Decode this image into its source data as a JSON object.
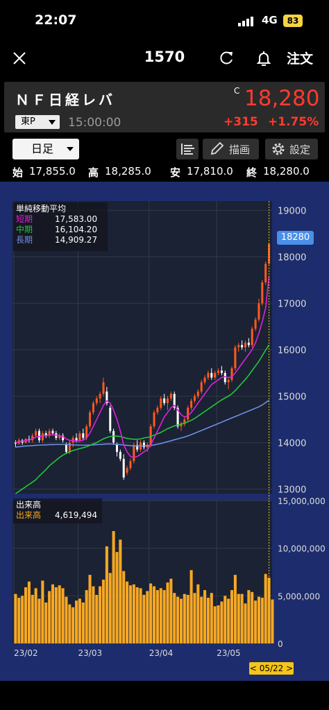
{
  "status_bar": {
    "time": "22:07",
    "network": "4G",
    "battery": "83"
  },
  "header": {
    "code": "1570",
    "order_label": "注文"
  },
  "stock": {
    "name": "ＮＦ日経レバ",
    "market": "東P",
    "time": "15:00:00",
    "c_mark": "C",
    "price": "18,280",
    "change": "+315",
    "change_pct": "+1.75%"
  },
  "toolbar": {
    "period": "日足",
    "draw_label": "描画",
    "settings_label": "設定"
  },
  "ohlc": {
    "open_label": "始",
    "open": "17,855.0",
    "high_label": "高",
    "high": "18,285.0",
    "low_label": "安",
    "low": "17,810.0",
    "close_label": "終",
    "close": "18,280.0"
  },
  "ma_legend": {
    "title": "単純移動平均",
    "short_label": "短期",
    "short_value": "17,583.00",
    "mid_label": "中期",
    "mid_value": "16,104.20",
    "long_label": "長期",
    "long_value": "14,909.27"
  },
  "volume_legend": {
    "title": "出来高",
    "label": "出来高",
    "value": "4,619,494"
  },
  "price_tag": "18280",
  "date_tag": "< 05/22 >",
  "colors": {
    "up": "#ff5a1f",
    "down": "#ffffff",
    "short_ma": "#e020e0",
    "mid_ma": "#22c93a",
    "long_ma": "#6f8fe6",
    "volume": "#f7a823",
    "chart_bg": "#1c2c6c",
    "price_red": "#ff3b30"
  },
  "chart_data": [
    {
      "type": "candlestick",
      "y_axis": {
        "ticks": [
          13000,
          14000,
          15000,
          16000,
          17000,
          18000,
          19000
        ],
        "range": [
          12900,
          19200
        ]
      },
      "x_ticks": [
        "23/02",
        "23/03",
        "23/04",
        "23/05"
      ],
      "candles": [
        [
          14000,
          14050,
          13900,
          13980
        ],
        [
          13980,
          14100,
          13950,
          14050
        ],
        [
          14050,
          14080,
          13950,
          14000
        ],
        [
          14000,
          14100,
          13980,
          14080
        ],
        [
          14080,
          14150,
          14000,
          14050
        ],
        [
          14050,
          14200,
          14000,
          14150
        ],
        [
          14150,
          14300,
          14100,
          14250
        ],
        [
          14250,
          14300,
          14000,
          14050
        ],
        [
          14050,
          14250,
          14000,
          14200
        ],
        [
          14200,
          14250,
          14100,
          14150
        ],
        [
          14150,
          14300,
          14100,
          14250
        ],
        [
          14250,
          14300,
          14150,
          14200
        ],
        [
          14200,
          14250,
          14050,
          14100
        ],
        [
          14100,
          14200,
          14050,
          14150
        ],
        [
          14150,
          14200,
          14000,
          14050
        ],
        [
          13950,
          14000,
          13750,
          13800
        ],
        [
          13800,
          14050,
          13750,
          14000
        ],
        [
          14000,
          14150,
          13900,
          14100
        ],
        [
          14100,
          14200,
          14000,
          14050
        ],
        [
          14050,
          14250,
          14000,
          14200
        ],
        [
          14200,
          14300,
          14050,
          14100
        ],
        [
          14100,
          14400,
          14050,
          14350
        ],
        [
          14350,
          14700,
          14300,
          14650
        ],
        [
          14650,
          14900,
          14600,
          14850
        ],
        [
          14850,
          15000,
          14800,
          14950
        ],
        [
          14950,
          15100,
          14850,
          15050
        ],
        [
          15050,
          15400,
          15000,
          15300
        ],
        [
          15100,
          15200,
          14800,
          14850
        ],
        [
          14750,
          14800,
          14200,
          14250
        ],
        [
          14250,
          14300,
          13950,
          14000
        ],
        [
          13950,
          14000,
          13700,
          13800
        ],
        [
          13800,
          13850,
          13600,
          13650
        ],
        [
          13650,
          13750,
          13200,
          13250
        ],
        [
          13350,
          13500,
          13300,
          13450
        ],
        [
          13450,
          13650,
          13400,
          13600
        ],
        [
          13600,
          14000,
          13550,
          13950
        ],
        [
          13950,
          14050,
          13800,
          13850
        ],
        [
          13850,
          14050,
          13800,
          14000
        ],
        [
          14000,
          14050,
          13850,
          13900
        ],
        [
          13900,
          14000,
          13800,
          13950
        ],
        [
          13950,
          14400,
          13900,
          14350
        ],
        [
          14350,
          14700,
          14300,
          14650
        ],
        [
          14650,
          14800,
          14600,
          14750
        ],
        [
          14750,
          15000,
          14700,
          14950
        ],
        [
          14950,
          15050,
          14800,
          14850
        ],
        [
          14850,
          15000,
          14700,
          14950
        ],
        [
          14950,
          15100,
          14900,
          15050
        ],
        [
          15050,
          15100,
          14700,
          14750
        ],
        [
          14750,
          14800,
          14300,
          14350
        ],
        [
          14350,
          14450,
          14250,
          14400
        ],
        [
          14400,
          14550,
          14350,
          14500
        ],
        [
          14500,
          14800,
          14450,
          14750
        ],
        [
          14750,
          14950,
          14700,
          14900
        ],
        [
          14900,
          15050,
          14850,
          15000
        ],
        [
          15000,
          15150,
          14950,
          15100
        ],
        [
          15100,
          15350,
          15050,
          15300
        ],
        [
          15300,
          15450,
          15250,
          15400
        ],
        [
          15400,
          15550,
          15350,
          15500
        ],
        [
          15500,
          15600,
          15350,
          15400
        ],
        [
          15400,
          15550,
          15350,
          15500
        ],
        [
          15500,
          15600,
          15450,
          15550
        ],
        [
          15550,
          15650,
          15450,
          15500
        ],
        [
          15500,
          15550,
          15250,
          15300
        ],
        [
          15300,
          15400,
          15150,
          15350
        ],
        [
          15350,
          15650,
          15300,
          15600
        ],
        [
          15600,
          16100,
          15550,
          16050
        ],
        [
          16050,
          16150,
          15950,
          16100
        ],
        [
          16100,
          16200,
          16000,
          16050
        ],
        [
          16050,
          16200,
          15950,
          16150
        ],
        [
          16150,
          16250,
          16050,
          16100
        ],
        [
          16100,
          16500,
          16050,
          16450
        ],
        [
          16450,
          16700,
          16400,
          16650
        ],
        [
          16650,
          17100,
          16600,
          17000
        ],
        [
          17000,
          17500,
          16950,
          17450
        ],
        [
          17450,
          17900,
          17400,
          17850
        ],
        [
          17855,
          18285,
          17810,
          18280
        ]
      ],
      "ma_short": [
        14000,
        14020,
        14030,
        14040,
        14060,
        14080,
        14120,
        14130,
        14150,
        14150,
        14160,
        14170,
        14160,
        14150,
        14130,
        14080,
        14050,
        14040,
        14030,
        14040,
        14050,
        14100,
        14200,
        14350,
        14500,
        14650,
        14800,
        14900,
        14850,
        14700,
        14500,
        14250,
        13950,
        13800,
        13700,
        13680,
        13700,
        13750,
        13800,
        13850,
        13950,
        14100,
        14250,
        14400,
        14550,
        14650,
        14750,
        14800,
        14700,
        14600,
        14550,
        14580,
        14650,
        14750,
        14850,
        14950,
        15050,
        15150,
        15250,
        15300,
        15350,
        15400,
        15420,
        15400,
        15420,
        15500,
        15600,
        15700,
        15800,
        15900,
        16000,
        16150,
        16350,
        16600,
        16900,
        17580
      ],
      "ma_mid": [
        12900,
        12950,
        13000,
        13050,
        13100,
        13150,
        13200,
        13280,
        13350,
        13420,
        13500,
        13560,
        13620,
        13680,
        13730,
        13770,
        13800,
        13830,
        13850,
        13870,
        13890,
        13910,
        13940,
        13970,
        14000,
        14040,
        14080,
        14110,
        14130,
        14140,
        14140,
        14130,
        14110,
        14090,
        14080,
        14070,
        14070,
        14080,
        14100,
        14110,
        14130,
        14160,
        14190,
        14220,
        14260,
        14300,
        14330,
        14360,
        14380,
        14400,
        14420,
        14450,
        14480,
        14520,
        14570,
        14620,
        14670,
        14720,
        14770,
        14820,
        14870,
        14920,
        14960,
        15000,
        15050,
        15120,
        15200,
        15280,
        15360,
        15450,
        15550,
        15650,
        15750,
        15870,
        15990,
        16104
      ],
      "ma_long": [
        13900,
        13910,
        13920,
        13925,
        13930,
        13935,
        13940,
        13945,
        13950,
        13950,
        13955,
        13955,
        13960,
        13960,
        13960,
        13958,
        13955,
        13950,
        13948,
        13945,
        13945,
        13945,
        13948,
        13950,
        13955,
        13960,
        13965,
        13970,
        13970,
        13968,
        13962,
        13955,
        13948,
        13940,
        13935,
        13930,
        13928,
        13928,
        13930,
        13935,
        13940,
        13950,
        13965,
        13980,
        14000,
        14020,
        14040,
        14060,
        14080,
        14100,
        14120,
        14145,
        14170,
        14200,
        14230,
        14260,
        14290,
        14320,
        14350,
        14380,
        14410,
        14440,
        14470,
        14500,
        14530,
        14560,
        14590,
        14620,
        14650,
        14680,
        14710,
        14740,
        14770,
        14810,
        14860,
        14909
      ]
    },
    {
      "type": "bar",
      "title": "出来高",
      "y_axis": {
        "ticks": [
          0,
          5000000,
          10000000,
          15000000
        ],
        "range": [
          0,
          15000000
        ]
      },
      "values": [
        5200000,
        4800000,
        5000000,
        5900000,
        6500000,
        5100000,
        5800000,
        4700000,
        6600000,
        4300000,
        5500000,
        6200000,
        5900000,
        6100000,
        5800000,
        4900000,
        4100000,
        3800000,
        4500000,
        4700000,
        4300000,
        5600000,
        7200000,
        6000000,
        5100000,
        6000000,
        6700000,
        10200000,
        7400000,
        11800000,
        9600000,
        10900000,
        7600000,
        6500000,
        6100000,
        6200000,
        5900000,
        5800000,
        5100000,
        5500000,
        6300000,
        6000000,
        5600000,
        5800000,
        5600000,
        6400000,
        6800000,
        5300000,
        4900000,
        4700000,
        5200000,
        5100000,
        7700000,
        5300000,
        6200000,
        4900000,
        5600000,
        4800000,
        5300000,
        3900000,
        4000000,
        4400000,
        5000000,
        4700000,
        5600000,
        7200000,
        5200000,
        5200000,
        4200000,
        5600000,
        5400000,
        4500000,
        4900000,
        4800000,
        7300000,
        6900000,
        4619494
      ]
    }
  ]
}
